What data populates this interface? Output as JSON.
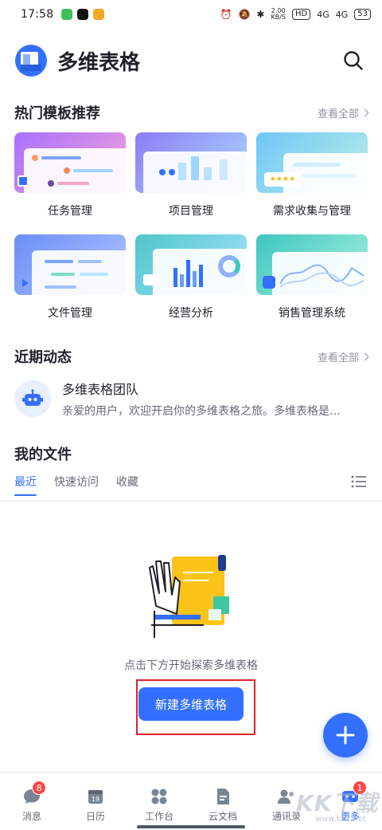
{
  "status_bar": {
    "time": "17:58",
    "net_speed_top": "2.00",
    "net_speed_bottom": "KB/S",
    "hd": "HD",
    "sig1": "4G",
    "sig2": "4G",
    "battery": "53"
  },
  "header": {
    "title": "多维表格"
  },
  "templates": {
    "title": "热门模板推荐",
    "view_all": "查看全部",
    "items": [
      {
        "label": "任务管理"
      },
      {
        "label": "项目管理"
      },
      {
        "label": "需求收集与管理"
      },
      {
        "label": "文件管理"
      },
      {
        "label": "经营分析"
      },
      {
        "label": "销售管理系统"
      }
    ]
  },
  "recent": {
    "title": "近期动态",
    "view_all": "查看全部",
    "item": {
      "title": "多维表格团队",
      "desc": "亲爱的用户，欢迎开启你的多维表格之旅。多维表格是…"
    }
  },
  "my_files": {
    "title": "我的文件",
    "tabs": [
      "最近",
      "快速访问",
      "收藏"
    ]
  },
  "empty_state": {
    "text": "点击下方开始探索多维表格",
    "button": "新建多维表格"
  },
  "bottom_nav": {
    "items": [
      {
        "label": "消息",
        "badge": "8"
      },
      {
        "label": "日历",
        "icon_text": "19"
      },
      {
        "label": "工作台"
      },
      {
        "label": "云文档"
      },
      {
        "label": "通讯录"
      },
      {
        "label": "更多",
        "badge": "1"
      }
    ]
  },
  "watermark": {
    "text": "KK下载",
    "sub": "www.kkx.net"
  },
  "colors": {
    "accent": "#3370ff",
    "badge": "#f54a45",
    "highlight": "#e0212b"
  }
}
